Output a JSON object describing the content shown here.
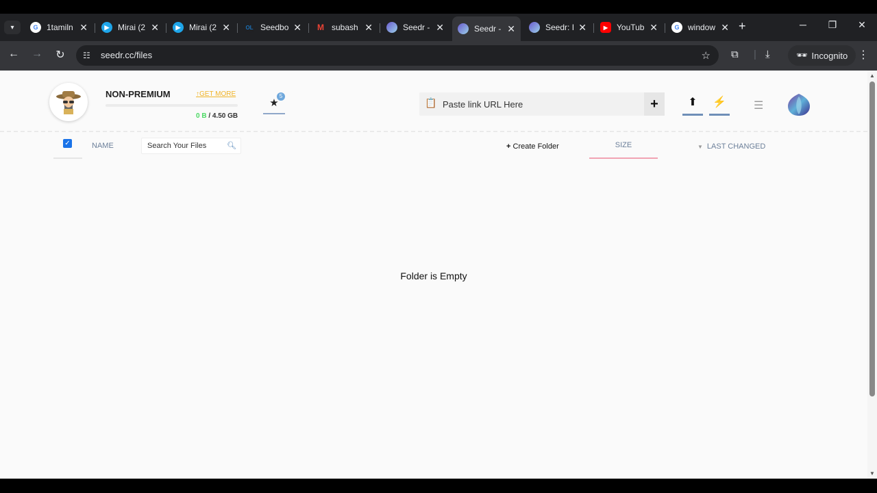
{
  "browser": {
    "tabs": [
      {
        "title": "1tamiln",
        "icon": "google-icon"
      },
      {
        "title": "Mirai (2",
        "icon": "play-icon"
      },
      {
        "title": "Mirai (2",
        "icon": "play-icon"
      },
      {
        "title": "Seedbo",
        "icon": "seedbox-icon"
      },
      {
        "title": "subash",
        "icon": "gmail-icon"
      },
      {
        "title": "Seedr -",
        "icon": "seedr-icon"
      },
      {
        "title": "Seedr -",
        "icon": "seedr-icon"
      },
      {
        "title": "Seedr: I",
        "icon": "seedr-icon"
      },
      {
        "title": "YouTub",
        "icon": "youtube-icon"
      },
      {
        "title": "window",
        "icon": "google-icon"
      }
    ],
    "active_tab_index": 6,
    "url": "seedr.cc/files",
    "incognito_label": "Incognito"
  },
  "header": {
    "plan_label": "NON-PREMIUM",
    "get_more_label": "GET MORE",
    "storage_used": "0 B",
    "storage_total": "/ 4.50 GB",
    "storage_used_fraction": 0,
    "stars_badge": "5",
    "paste_placeholder": "Paste link URL Here"
  },
  "file_list": {
    "name_header": "NAME",
    "search_placeholder": "Search Your Files",
    "create_folder_label": "Create Folder",
    "size_header": "SIZE",
    "last_changed_header": "LAST CHANGED",
    "empty_message": "Folder is Empty"
  },
  "colors": {
    "accent_blue": "#6f8fb8",
    "get_more": "#f0b429",
    "used_green": "#4cd964",
    "size_underline": "#f1a3b3"
  }
}
